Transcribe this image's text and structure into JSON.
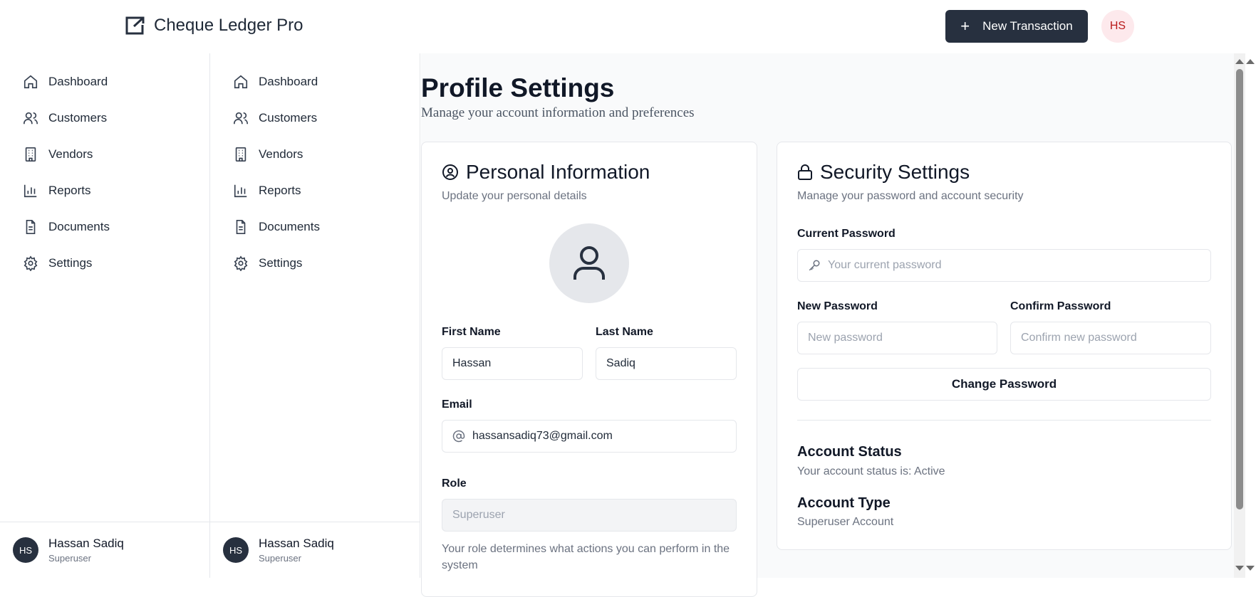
{
  "app": {
    "title": "Cheque Ledger Pro",
    "new_tx_label": "New Transaction",
    "avatar_initials": "HS"
  },
  "sidebar": {
    "items": [
      {
        "label": "Dashboard",
        "icon": "home-icon"
      },
      {
        "label": "Customers",
        "icon": "users-icon"
      },
      {
        "label": "Vendors",
        "icon": "building-icon"
      },
      {
        "label": "Reports",
        "icon": "bar-chart-icon"
      },
      {
        "label": "Documents",
        "icon": "document-icon"
      },
      {
        "label": "Settings",
        "icon": "gear-icon"
      }
    ],
    "user": {
      "initials": "HS",
      "name": "Hassan Sadiq",
      "role": "Superuser"
    }
  },
  "page": {
    "title": "Profile Settings",
    "subtitle": "Manage your account information and preferences"
  },
  "personal": {
    "title": "Personal Information",
    "subtitle": "Update your personal details",
    "first_name_label": "First Name",
    "first_name_value": "Hassan",
    "last_name_label": "Last Name",
    "last_name_value": "Sadiq",
    "email_label": "Email",
    "email_value": "hassansadiq73@gmail.com",
    "role_label": "Role",
    "role_value": "Superuser",
    "role_help": "Your role determines what actions you can perform in the system"
  },
  "security": {
    "title": "Security Settings",
    "subtitle": "Manage your password and account security",
    "current_label": "Current Password",
    "current_placeholder": "Your current password",
    "new_label": "New Password",
    "new_placeholder": "New password",
    "confirm_label": "Confirm Password",
    "confirm_placeholder": "Confirm new password",
    "change_button": "Change Password",
    "status_heading": "Account Status",
    "status_text": "Your account status is: Active",
    "type_heading": "Account Type",
    "type_text": "Superuser Account"
  },
  "colors": {
    "primary": "#27303f",
    "avatar_bg": "#fde9ec",
    "avatar_text": "#b91c1c"
  }
}
